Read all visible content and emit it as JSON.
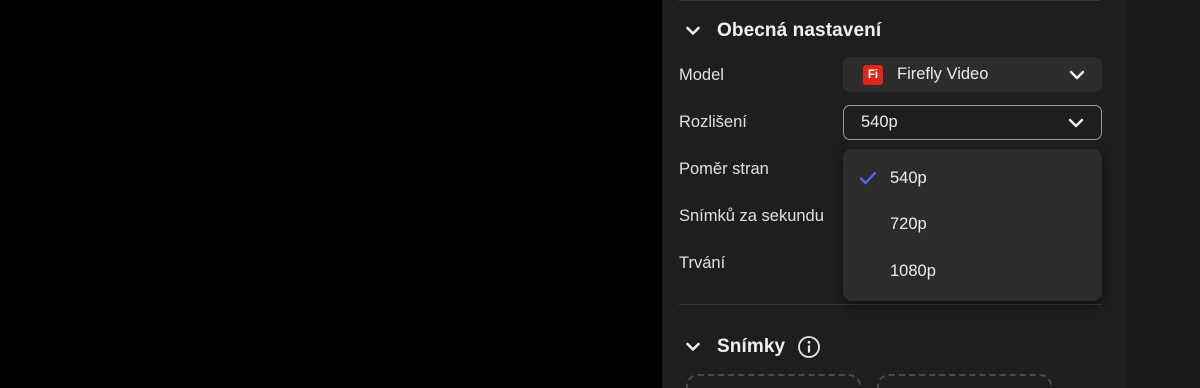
{
  "general_section": {
    "title": "Obecná nastavení",
    "expanded": true
  },
  "settings": {
    "model_label": "Model",
    "model_value": "Firefly Video",
    "model_badge": "Fi",
    "resolution_label": "Rozlišení",
    "resolution_value": "540p",
    "aspect_label": "Poměr stran",
    "fps_label": "Snímků za sekundu",
    "duration_label": "Trvání"
  },
  "resolution_dropdown": {
    "options": [
      {
        "label": "540p",
        "selected": true
      },
      {
        "label": "720p",
        "selected": false
      },
      {
        "label": "1080p",
        "selected": false
      }
    ]
  },
  "frames_section": {
    "title": "Snímky",
    "expanded": true
  },
  "icons": {
    "section_chevron": "chevron-down-icon",
    "picker_caret": "chevron-down-icon",
    "selected_check": "checkmark-icon",
    "info": "info-icon"
  },
  "colors": {
    "panel_bg": "#1e1e1e",
    "canvas_bg": "#000000",
    "firefly_badge": "#e0261b",
    "check_accent": "#4a6cf7",
    "text": "#e6e6e6"
  }
}
